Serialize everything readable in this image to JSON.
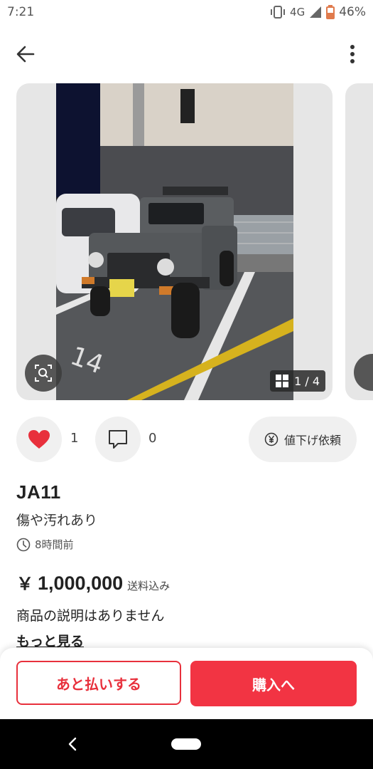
{
  "status_bar": {
    "time": "7:21",
    "network": "4G",
    "battery": "46%"
  },
  "app_bar": {
    "back_icon": "arrow-left-icon",
    "menu_icon": "more-vert-icon"
  },
  "gallery": {
    "current": "1",
    "separator": "/",
    "total": "4",
    "counter_text": "1 / 4"
  },
  "engagement": {
    "likes": "1",
    "comments": "0",
    "price_request_label": "値下げ依頼"
  },
  "item": {
    "title": "JA11",
    "condition": "傷や汚れあり",
    "posted": "8時間前",
    "currency": "￥",
    "price": "1,000,000",
    "shipping": "送料込み",
    "description": "商品の説明はありません",
    "more_label": "もっと見る"
  },
  "bottom_bar": {
    "pay_later_label": "あと払いする",
    "buy_label": "購入へ"
  },
  "colors": {
    "accent": "#f23443",
    "like_heart": "#e8303c"
  }
}
